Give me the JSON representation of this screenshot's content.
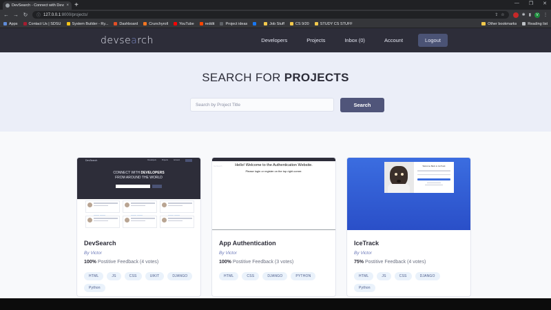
{
  "browser": {
    "tab_title": "DevSearch - Connect with Devs",
    "tab_close": "×",
    "new_tab": "+",
    "window_controls": [
      "—",
      "❐",
      "✕"
    ],
    "url_host": "127.0.0.1",
    "url_rest": ":8000/projects/",
    "nav": {
      "back": "←",
      "forward": "→",
      "reload": "↻"
    },
    "bookmarks": [
      {
        "label": "Apps",
        "color": "#5f8bd8"
      },
      {
        "label": "Contact Us | SDSU",
        "color": "#a51c30"
      },
      {
        "label": "System Builder - Ry...",
        "color": "#f5c518"
      },
      {
        "label": "Dashboard",
        "color": "#e34f26"
      },
      {
        "label": "Crunchyroll",
        "color": "#f47521"
      },
      {
        "label": "YouTube",
        "color": "#ff0000"
      },
      {
        "label": "reddit",
        "color": "#ff4500"
      },
      {
        "label": "Project ideas",
        "color": "#5f6368"
      },
      {
        "label": "",
        "color": "#1877f2"
      },
      {
        "label": "Job Stuff",
        "color": "#f2c94c"
      },
      {
        "label": "CS 9/20",
        "color": "#f2c94c"
      },
      {
        "label": "STUDY CS STUFF",
        "color": "#f2c94c"
      }
    ],
    "other_bookmarks": "Other bookmarks",
    "reading_list": "Reading list",
    "profile_letter": "V"
  },
  "site": {
    "logo_prefix": "devse",
    "logo_accent": "a",
    "logo_suffix": "rch",
    "nav": [
      "Developers",
      "Projects",
      "Inbox (0)",
      "Account"
    ],
    "logout": "Logout"
  },
  "hero": {
    "title_light": "SEARCH FOR ",
    "title_bold": "PROJECTS",
    "search_placeholder": "Search by Project Title",
    "search_button": "Search"
  },
  "thumbs": {
    "devsearch": {
      "logo": "DevSearch",
      "nav": [
        "Developers",
        "Projects",
        "Account"
      ],
      "heading_light": "CONNECT WITH",
      "heading_bold": "DEVELOPERS",
      "heading_tail": "FROM AROUND THE WORLD"
    },
    "auth": {
      "bar": "DevSearch",
      "hello": "Hello! Welcome to the Authentication Website.",
      "sub": "Please login or register on the top right corner."
    },
    "icetrack": {
      "form_title": "Welcome Back to IceTrack"
    }
  },
  "projects": [
    {
      "title": "DevSearch",
      "author": "By Victor",
      "feedback_pct": "100%",
      "feedback_text": " Postitive Feedback (4 votes)",
      "tags": [
        "HTML",
        "JS",
        "CSS",
        "UIKIT",
        "DJANGO",
        "Python"
      ]
    },
    {
      "title": "App Authentication",
      "author": "By Victor",
      "feedback_pct": "100%",
      "feedback_text": " Postitive Feedback (3 votes)",
      "tags": [
        "HTML",
        "CSS",
        "DJANGO",
        "PYTHON"
      ]
    },
    {
      "title": "IceTrack",
      "author": "By Victor",
      "feedback_pct": "75%",
      "feedback_text": " Postitive Feedback (4 votes)",
      "tags": [
        "HTML",
        "JS",
        "CSS",
        "DJANGO",
        "Python"
      ]
    }
  ]
}
